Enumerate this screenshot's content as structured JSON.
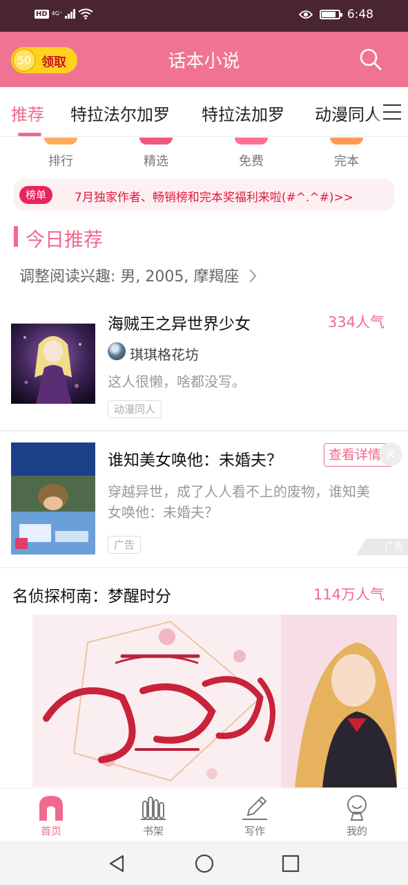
{
  "status_bar": {
    "hd": "HD",
    "network": "4G⁺",
    "time": "6:48"
  },
  "header": {
    "coin_value": "50",
    "coin_label": "领取",
    "title": "话本小说",
    "search_icon": "search-icon"
  },
  "tabs": [
    "推荐",
    "特拉法尔加罗",
    "特拉法加罗",
    "动漫同人"
  ],
  "categories": [
    "排行",
    "精选",
    "免费",
    "完本"
  ],
  "notice": {
    "badge": "榜单",
    "text": "7月独家作者、畅销榜和完本奖福利来啦(#^.^#)>>"
  },
  "section": {
    "title": "今日推荐",
    "interest": "调整阅读兴趣: 男, 2005, 摩羯座"
  },
  "book1": {
    "title": "海贼王之异世界少女",
    "popularity": "334人气",
    "author": "琪琪格花坊",
    "desc": "这人很懒，啥都没写。",
    "tag": "动漫同人"
  },
  "ad": {
    "title": "谁知美女唤他：未婚夫？",
    "button": "查看详情",
    "desc_line1": "穿越异世，成了人人看不上的废物，谁知美",
    "desc_line2": "女唤他：未婚夫？",
    "tag": "广告",
    "ad_mark": "广告"
  },
  "book2": {
    "title": "名侦探柯南：梦醒时分",
    "popularity": "114万人气"
  },
  "bottom_nav": [
    "首页",
    "书架",
    "写作",
    "我的"
  ],
  "colors": {
    "accent": "#ef6a8c",
    "header": "#f07492",
    "status_bar": "#4a2530",
    "coin": "#ffd21f"
  }
}
